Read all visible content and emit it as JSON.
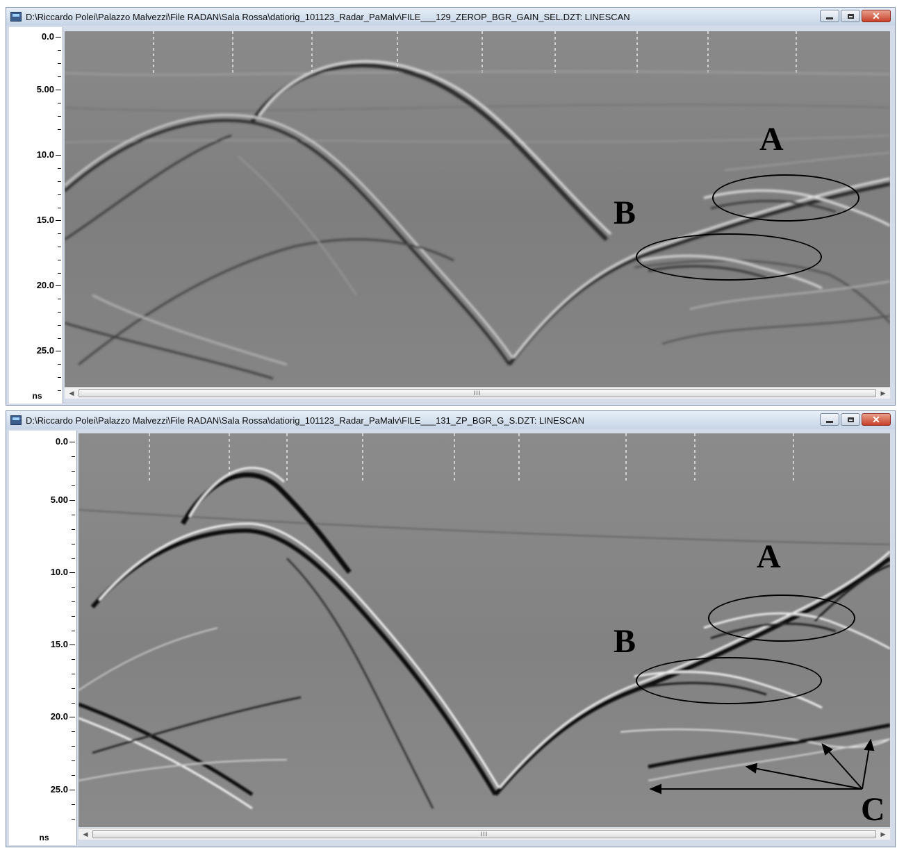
{
  "windows": [
    {
      "title": "D:\\Riccardo Polei\\Palazzo Malvezzi\\File RADAN\\Sala Rossa\\datiorig_101123_Radar_PaMalv\\FILE___129_ZEROP_BGR_GAIN_SEL.DZT:  LINESCAN",
      "axis": {
        "unit": "ns",
        "labels": [
          "0.0",
          "5.00",
          "10.0",
          "15.0",
          "20.0",
          "25.0"
        ]
      },
      "scroll_grip": "III",
      "annotations": {
        "a": "A",
        "b": "B"
      }
    },
    {
      "title": "D:\\Riccardo Polei\\Palazzo Malvezzi\\File RADAN\\Sala Rossa\\datiorig_101123_Radar_PaMalv\\FILE___131_ZP_BGR_G_S.DZT:  LINESCAN",
      "axis": {
        "unit": "ns",
        "labels": [
          "0.0",
          "5.00",
          "10.0",
          "15.0",
          "20.0",
          "25.0"
        ]
      },
      "scroll_grip": "III",
      "annotations": {
        "a": "A",
        "b": "B",
        "c": "C"
      }
    }
  ],
  "icons": {
    "app": "radan-app-icon",
    "minimize": "minimize-icon",
    "maximize": "maximize-icon",
    "close": "close-icon",
    "scroll_left": "scroll-left-arrow-icon",
    "scroll_right": "scroll-right-arrow-icon"
  },
  "colors": {
    "titlebar": "#d3dce8",
    "close_button": "#c8412a",
    "radargram_gray": "#7d7d7d"
  }
}
